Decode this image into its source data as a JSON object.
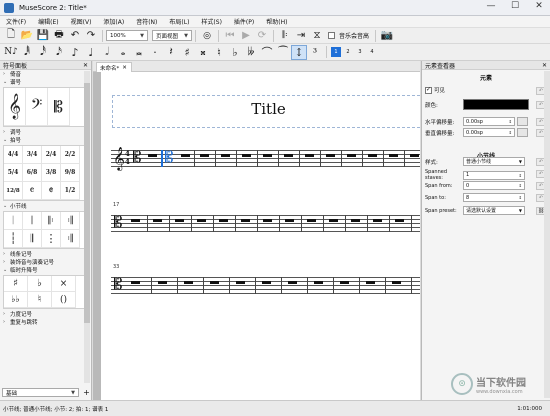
{
  "window": {
    "title": "MuseScore 2: Title*",
    "buttons": [
      "—",
      "☐",
      "✕"
    ]
  },
  "menu": [
    "文件(F)",
    "编辑(E)",
    "视图(V)",
    "添加(A)",
    "音符(N)",
    "布局(L)",
    "样式(S)",
    "插件(P)",
    "帮助(H)"
  ],
  "toolbar": {
    "zoom": "100%",
    "view_mode": "页面视图",
    "concert_pitch": "音乐会音高"
  },
  "voices": [
    "1",
    "2",
    "3",
    "4"
  ],
  "palette": {
    "title": "符号面板",
    "close": "✕",
    "categories": [
      "谱号",
      "调号",
      "拍号",
      "小节线",
      "线条记号",
      "装饰音与演奏记号",
      "临时升降号",
      "力度记号",
      "重复与跳转"
    ],
    "top_partial": "倚音",
    "time_sigs": [
      "4/4",
      "3/4",
      "2/4",
      "2/2",
      "5/4",
      "6/8",
      "3/8",
      "9/8",
      "12/8",
      "𝄴",
      "𝄵",
      "1/2"
    ],
    "accidentals": [
      "♯",
      "♭",
      "×",
      "♭♭",
      "♮",
      "()"
    ],
    "workspace": "基础",
    "add": "+"
  },
  "tab": {
    "label": "未命名*",
    "close": "✕"
  },
  "score": {
    "title": "Title",
    "measure_numbers": [
      "17",
      "33"
    ]
  },
  "inspector": {
    "title": "元素查看器",
    "close": "✕",
    "element_header": "元素",
    "visible_label": "可见",
    "color_label": "颜色:",
    "color_value": "#000000",
    "h_offset_label": "水平偏移量:",
    "h_offset_value": "0.00sp",
    "v_offset_label": "垂直偏移量:",
    "v_offset_value": "0.00sp",
    "barline_header": "小节线",
    "style_label": "样式:",
    "style_value": "普通小节线",
    "staves_label": "Spanned staves:",
    "staves_value": "1",
    "from_label": "Span from:",
    "from_value": "0",
    "to_label": "Span to:",
    "to_value": "8",
    "preset_label": "Span preset:",
    "preset_value": "请选默认设置",
    "reset": "↶"
  },
  "status": {
    "text": "小节线;  普通小节线;  小节: 2;  拍: 1;  谱表 1",
    "coord": "1:01:000"
  },
  "watermark": {
    "logo": "⊙",
    "text": "当下软件园",
    "url": "www.downxia.com"
  }
}
